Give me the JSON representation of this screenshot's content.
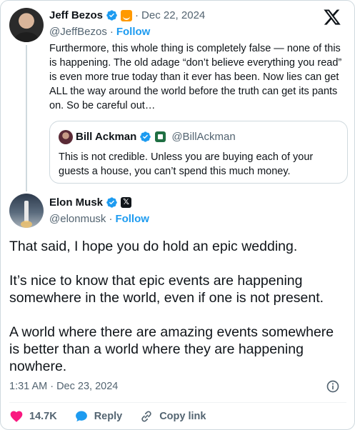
{
  "parent_tweet": {
    "author_name": "Jeff Bezos",
    "handle": "@JeffBezos",
    "separator": "·",
    "date": "Dec 22, 2024",
    "follow_label": "Follow",
    "text": "Furthermore, this whole thing is completely false — none of this is happening. The old adage “don’t believe everything you read” is even more true today than it ever has been. Now lies can get ALL the way around the world before the truth can get its pants on. So be careful out…",
    "quote": {
      "author_name": "Bill Ackman",
      "handle": "@BillAckman",
      "text": "This is not credible. Unless you are buying each of your guests a house, you can’t spend this much money."
    }
  },
  "main_tweet": {
    "author_name": "Elon Musk",
    "handle": "@elonmusk",
    "separator": "·",
    "follow_label": "Follow",
    "paragraphs": [
      "That said, I hope you do hold an epic wedding.",
      "It’s nice to know that epic events are happening somewhere in the world, even if one is not present.",
      "A world where there are amazing events somewhere is better than a world where they are happening nowhere."
    ],
    "timestamp": "1:31 AM · Dec 23, 2024"
  },
  "actions": {
    "like_count": "14.7K",
    "reply_label": "Reply",
    "copy_link_label": "Copy link"
  },
  "colors": {
    "accent": "#1d9bf0",
    "text": "#0f1419",
    "muted": "#536471",
    "like": "#f91880",
    "border": "#cfd9de"
  },
  "icons": [
    "verified-icon",
    "amazon-badge-icon",
    "x-logo-icon",
    "x-affiliate-badge-icon",
    "info-icon",
    "heart-icon",
    "reply-icon",
    "link-icon"
  ]
}
